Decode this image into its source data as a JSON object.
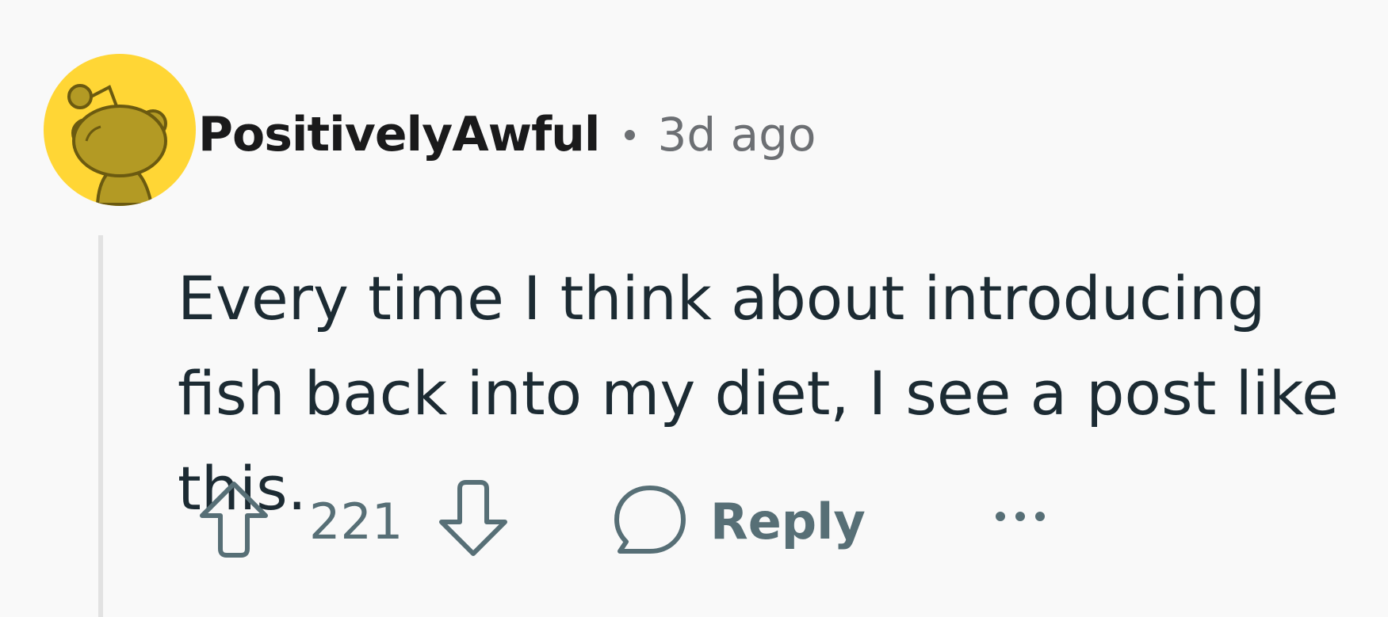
{
  "comment": {
    "author": "PositivelyAwful",
    "age": "3d ago",
    "avatar_icon": "snoo-avatar-icon",
    "avatar_background": "#ffd635",
    "body": "Every time I think about introducing fish back into my diet, I see a post like this.",
    "score": "221",
    "reply_label": "Reply"
  },
  "icons": {
    "upvote": "arrow-up-icon",
    "downvote": "arrow-down-icon",
    "reply": "speech-bubble-icon",
    "more": "ellipsis-icon"
  },
  "colors": {
    "background": "#f9f9f9",
    "username": "#1a1a1b",
    "meta": "#6c6f73",
    "body_text": "#1c2b33",
    "action": "#576f76",
    "thread_line": "#e2e2e2"
  }
}
